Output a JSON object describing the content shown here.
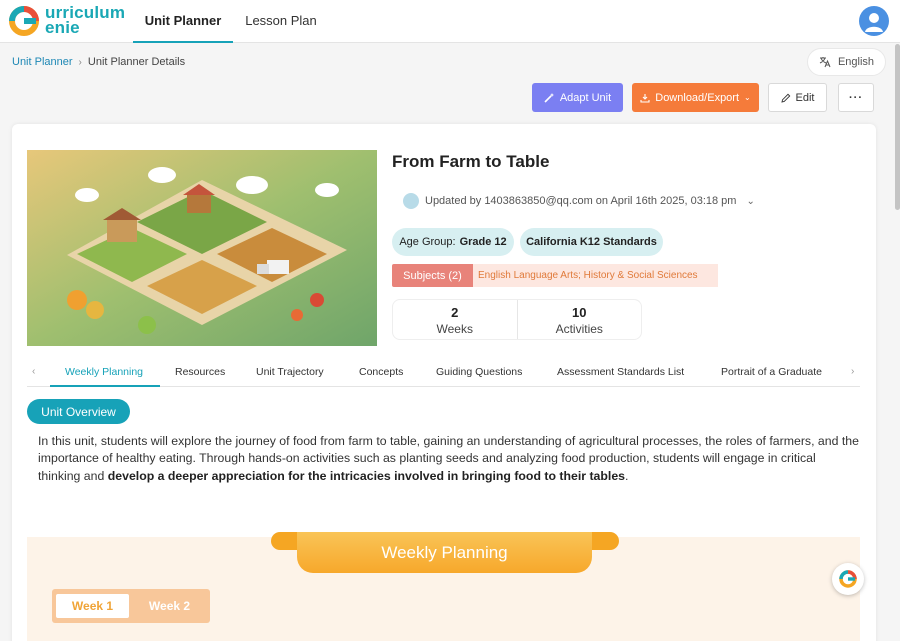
{
  "app": {
    "logo_line1": "urriculum",
    "logo_line2": "enie"
  },
  "nav": {
    "tabs": [
      {
        "label": "Unit Planner",
        "active": true
      },
      {
        "label": "Lesson Plan",
        "active": false
      }
    ]
  },
  "breadcrumb": {
    "root": "Unit Planner",
    "current": "Unit Planner Details"
  },
  "language": "English",
  "actions": {
    "adapt": "Adapt Unit",
    "export": "Download/Export",
    "edit": "Edit",
    "more": "···"
  },
  "unit": {
    "title": "From Farm to Table",
    "updated": "Updated by 1403863850@qq.com on April 16th 2025, 03:18 pm",
    "age_group_label": "Age Group:",
    "age_group_value": "Grade 12",
    "standards": "California K12 Standards",
    "subjects_label": "Subjects (2)",
    "subjects_value": "English Language Arts; History & Social Sciences",
    "weeks_num": "2",
    "weeks_label": "Weeks",
    "activities_num": "10",
    "activities_label": "Activities"
  },
  "tabs": [
    "Weekly Planning",
    "Resources",
    "Unit Trajectory",
    "Concepts",
    "Guiding Questions",
    "Assessment Standards List",
    "Portrait of a Graduate"
  ],
  "overview": {
    "label": "Unit Overview",
    "text_plain": "In this unit, students will explore the journey of food from farm to table, gaining an understanding of agricultural processes, the roles of farmers, and the importance of healthy eating. Through hands-on activities such as planting seeds and analyzing food production, students will engage in critical thinking and ",
    "text_bold": "develop a deeper appreciation for the intricacies involved in bringing food to their tables",
    "text_end": "."
  },
  "weekly_planning": {
    "banner": "Weekly Planning",
    "weeks": [
      "Week 1",
      "Week 2"
    ]
  },
  "colors": {
    "accent": "#17a2b8",
    "adapt": "#7b7ff2",
    "export": "#f57b3a",
    "subject": "#e8837a",
    "banner": "#f7a82b"
  }
}
